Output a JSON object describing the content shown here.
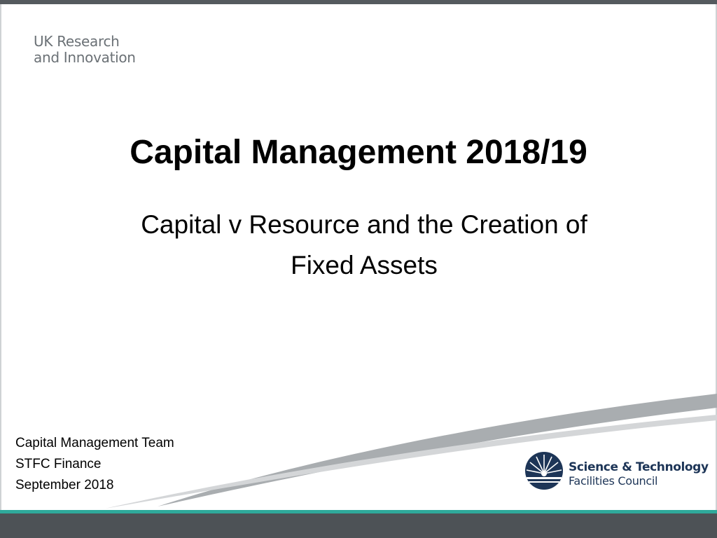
{
  "logo_left": {
    "line1": "UK Research",
    "line2": "and Innovation"
  },
  "slide": {
    "title": "Capital Management 2018/19",
    "subtitle_line1": "Capital v Resource and the Creation of",
    "subtitle_line2": "Fixed Assets"
  },
  "footer": {
    "team": "Capital Management Team",
    "department": "STFC Finance",
    "date": "September 2018"
  },
  "logo_right": {
    "line1": "Science & Technology",
    "line2": "Facilities Council"
  },
  "colors": {
    "top_bar": "#555a5e",
    "teal_accent": "#2fa99b",
    "bottom_bar": "#4d5256",
    "stfc_navy": "#1d3557",
    "logo_grey": "#6b7176"
  }
}
